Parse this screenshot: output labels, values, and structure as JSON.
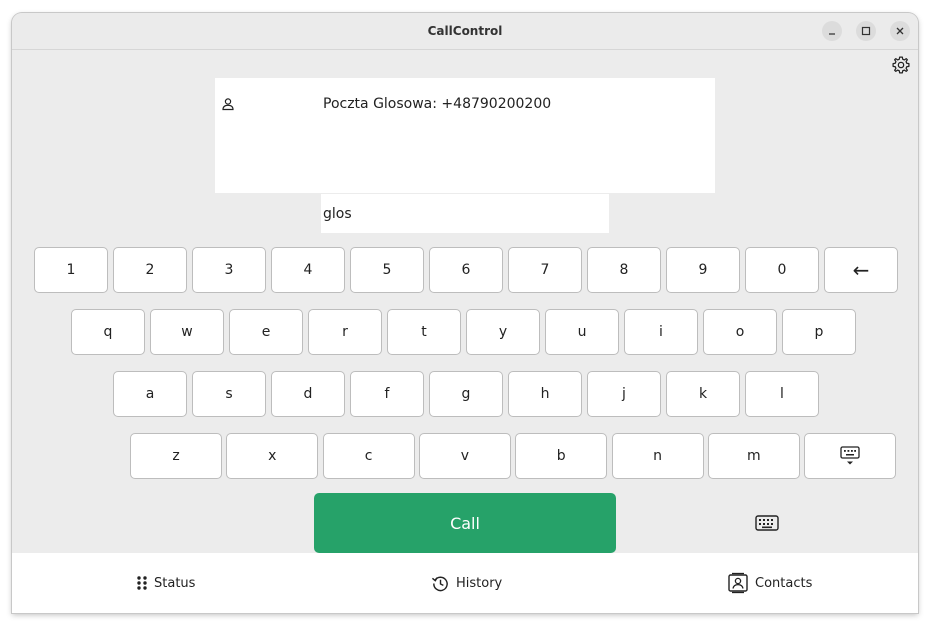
{
  "window": {
    "title": "CallControl",
    "controls": [
      "minimize-icon",
      "maximize-icon",
      "close-icon"
    ]
  },
  "header": {
    "settings_icon": "gear-icon"
  },
  "contact": {
    "icon": "person-icon",
    "text": "Poczta Glosowa: +48790200200"
  },
  "input": {
    "value": "glos"
  },
  "keyboard": {
    "row1": [
      "1",
      "2",
      "3",
      "4",
      "5",
      "6",
      "7",
      "8",
      "9",
      "0",
      "←"
    ],
    "row2": [
      "q",
      "w",
      "e",
      "r",
      "t",
      "y",
      "u",
      "i",
      "o",
      "p"
    ],
    "row3": [
      "a",
      "s",
      "d",
      "f",
      "g",
      "h",
      "j",
      "k",
      "l"
    ],
    "row4": [
      "z",
      "x",
      "c",
      "v",
      "b",
      "n",
      "m"
    ],
    "row4_extra_icon": "keyboard-hide-icon"
  },
  "call": {
    "label": "Call",
    "color": "#26a269"
  },
  "keyboard_toggle_icon": "keyboard-icon",
  "nav": [
    {
      "label": "Status",
      "icon": "dots-grid-icon"
    },
    {
      "label": "History",
      "icon": "history-icon"
    },
    {
      "label": "Contacts",
      "icon": "contacts-icon"
    }
  ]
}
